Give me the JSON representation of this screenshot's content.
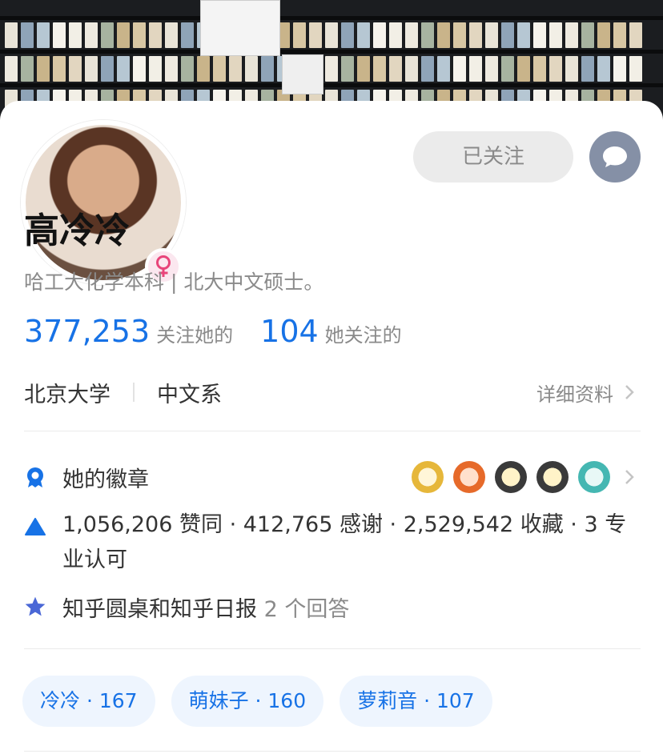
{
  "profile": {
    "name": "高冷冷",
    "bio": "哈工大化学本科 | 北大中文硕士。"
  },
  "actions": {
    "follow_label": "已关注"
  },
  "stats": {
    "followers_count": "377,253",
    "followers_label": "关注她的",
    "following_count": "104",
    "following_label": "她关注的"
  },
  "education": {
    "school": "北京大学",
    "major": "中文系",
    "detail_label": "详细资料"
  },
  "badges": {
    "label": "她的徽章",
    "icons": [
      "badge-1-icon",
      "badge-2-icon",
      "badge-3-icon",
      "badge-4-icon",
      "badge-5-icon"
    ]
  },
  "achievements": {
    "text": "1,056,206 赞同 · 412,765 感谢 · 2,529,542 收藏 · 3 专业认可"
  },
  "roundtable": {
    "label": "知乎圆桌和知乎日报",
    "count": "2 个回答"
  },
  "tags": [
    {
      "label": "冷冷 · 167"
    },
    {
      "label": "萌妹子 · 160"
    },
    {
      "label": "萝莉音 · 107"
    }
  ],
  "colors": {
    "accent": "#1772e6",
    "muted": "#8a8a8a",
    "badge_bg": "#fbe7ef",
    "gender_icon": "#e8447a",
    "message_button": "#8590a6",
    "star": "#4a67d6"
  }
}
